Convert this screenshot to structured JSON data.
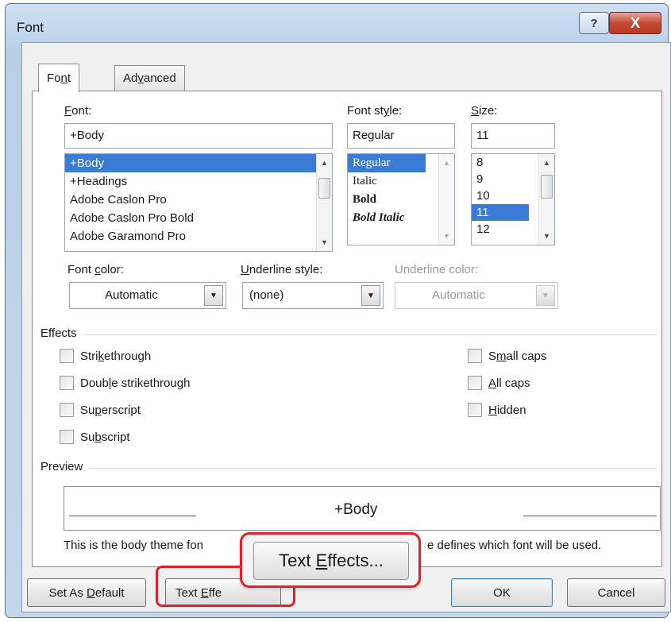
{
  "window": {
    "title": "Font",
    "help_label": "?",
    "close_label": "X"
  },
  "tabs": [
    {
      "pre": "Fo",
      "ul": "n",
      "post": "t"
    },
    {
      "pre": "Ad",
      "ul": "v",
      "post": "anced"
    }
  ],
  "font": {
    "label": {
      "pre": "",
      "ul": "F",
      "post": "ont:"
    },
    "value": "+Body",
    "items": [
      "+Body",
      "+Headings",
      "Adobe Caslon Pro",
      "Adobe Caslon Pro Bold",
      "Adobe Garamond Pro"
    ]
  },
  "style": {
    "label": {
      "pre": "Font st",
      "ul": "y",
      "post": "le:"
    },
    "value": "Regular",
    "items": [
      "Regular",
      "Italic",
      "Bold",
      "Bold Italic"
    ]
  },
  "size": {
    "label": {
      "pre": "",
      "ul": "S",
      "post": "ize:"
    },
    "value": "11",
    "items": [
      "8",
      "9",
      "10",
      "11",
      "12"
    ]
  },
  "font_color": {
    "label": {
      "pre": "Font ",
      "ul": "c",
      "post": "olor:"
    },
    "value": "Automatic"
  },
  "underline_style": {
    "label": {
      "pre": "",
      "ul": "U",
      "post": "nderline style:"
    },
    "value": "(none)"
  },
  "underline_color": {
    "label": "Underline color:",
    "value": "Automatic"
  },
  "effects": {
    "title": "Effects",
    "left": [
      {
        "pre": "Stri",
        "ul": "k",
        "post": "ethrough"
      },
      {
        "pre": "Doub",
        "ul": "l",
        "post": "e strikethrough"
      },
      {
        "pre": "Su",
        "ul": "p",
        "post": "erscript"
      },
      {
        "pre": "Su",
        "ul": "b",
        "post": "script"
      }
    ],
    "right": [
      {
        "pre": "S",
        "ul": "m",
        "post": "all caps"
      },
      {
        "pre": "",
        "ul": "A",
        "post": "ll caps"
      },
      {
        "pre": "",
        "ul": "H",
        "post": "idden"
      }
    ]
  },
  "preview": {
    "title": "Preview",
    "sample": "+Body",
    "note": "This is the body theme fon",
    "note_tail": "e defines which font will be used."
  },
  "buttons": {
    "set_default": {
      "pre": "Set As ",
      "ul": "D",
      "post": "efault"
    },
    "text_effects_small": {
      "pre": "Text ",
      "ul": "E",
      "post": "ffe"
    },
    "text_effects_big": {
      "pre": "Text ",
      "ul": "E",
      "post": "ffects..."
    },
    "ok": "OK",
    "cancel": "Cancel"
  },
  "colors": {
    "accent": "#e0202a",
    "selection": "#3a7bd5"
  }
}
